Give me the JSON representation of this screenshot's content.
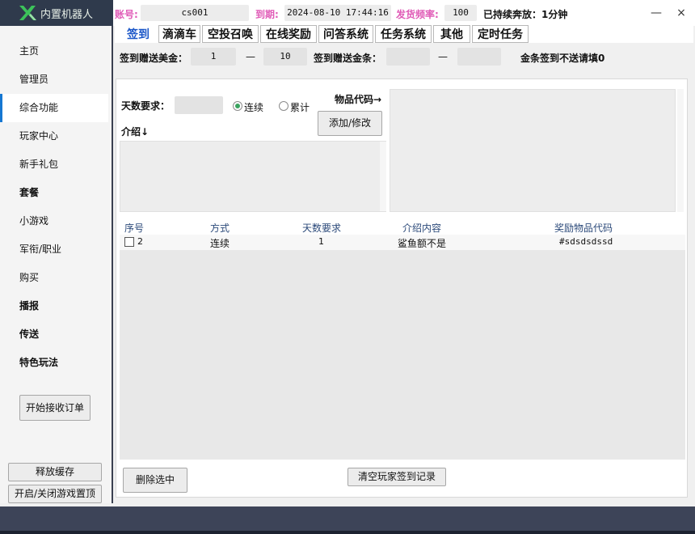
{
  "app": {
    "title": "内置机器人"
  },
  "header": {
    "account_label": "账号:",
    "account_value": "cs001",
    "expire_label": "到期:",
    "expire_value": "2024-08-10 17:44:16",
    "freq_label": "发货频率:",
    "freq_value": "100",
    "status_text": "已持续奔放：1分钟",
    "minimize": "—",
    "close": "×"
  },
  "sidebar": {
    "items": [
      {
        "label": "主页"
      },
      {
        "label": "管理员"
      },
      {
        "label": "综合功能"
      },
      {
        "label": "玩家中心"
      },
      {
        "label": "新手礼包"
      },
      {
        "label": "套餐"
      },
      {
        "label": "小游戏"
      },
      {
        "label": "军衔/职业"
      },
      {
        "label": "购买"
      },
      {
        "label": "播报"
      },
      {
        "label": "传送"
      },
      {
        "label": "特色玩法"
      }
    ],
    "start_orders_button": "开始接收订单",
    "release_cache_button": "释放缓存",
    "toggle_game_top_button": "开启/关闭游戏置顶"
  },
  "tabs": [
    "签到",
    "滴滴车",
    "空投召唤",
    "在线奖励",
    "问答系统",
    "任务系统",
    "其他",
    "定时任务"
  ],
  "signin": {
    "usd_label": "签到赠送美金：",
    "usd_min": "1",
    "dash": "—",
    "usd_max": "10",
    "gold_label": "签到赠送金条：",
    "gold_min": "",
    "gold_max": "",
    "gold_note": "金条签到不送请填0",
    "days_label": "天数要求：",
    "days_value": "",
    "mode_consecutive": "连续",
    "mode_cumulative": "累计",
    "item_code_label": "物品代码→",
    "intro_label": "介绍↓",
    "add_modify_button": "添加/修改",
    "delete_button": "删除选中",
    "clear_button": "清空玩家签到记录"
  },
  "table": {
    "columns": [
      "序号",
      "方式",
      "天数要求",
      "介绍内容",
      "奖励物品代码"
    ],
    "rows": [
      {
        "id": "2",
        "mode": "连续",
        "days": "1",
        "intro": "鲨鱼额不是",
        "code": "#sdsdsdssd"
      }
    ]
  },
  "colors": {
    "accent": "#1a56c8",
    "label_pink": "#e05bb7",
    "dark": "#2f3a4c"
  }
}
